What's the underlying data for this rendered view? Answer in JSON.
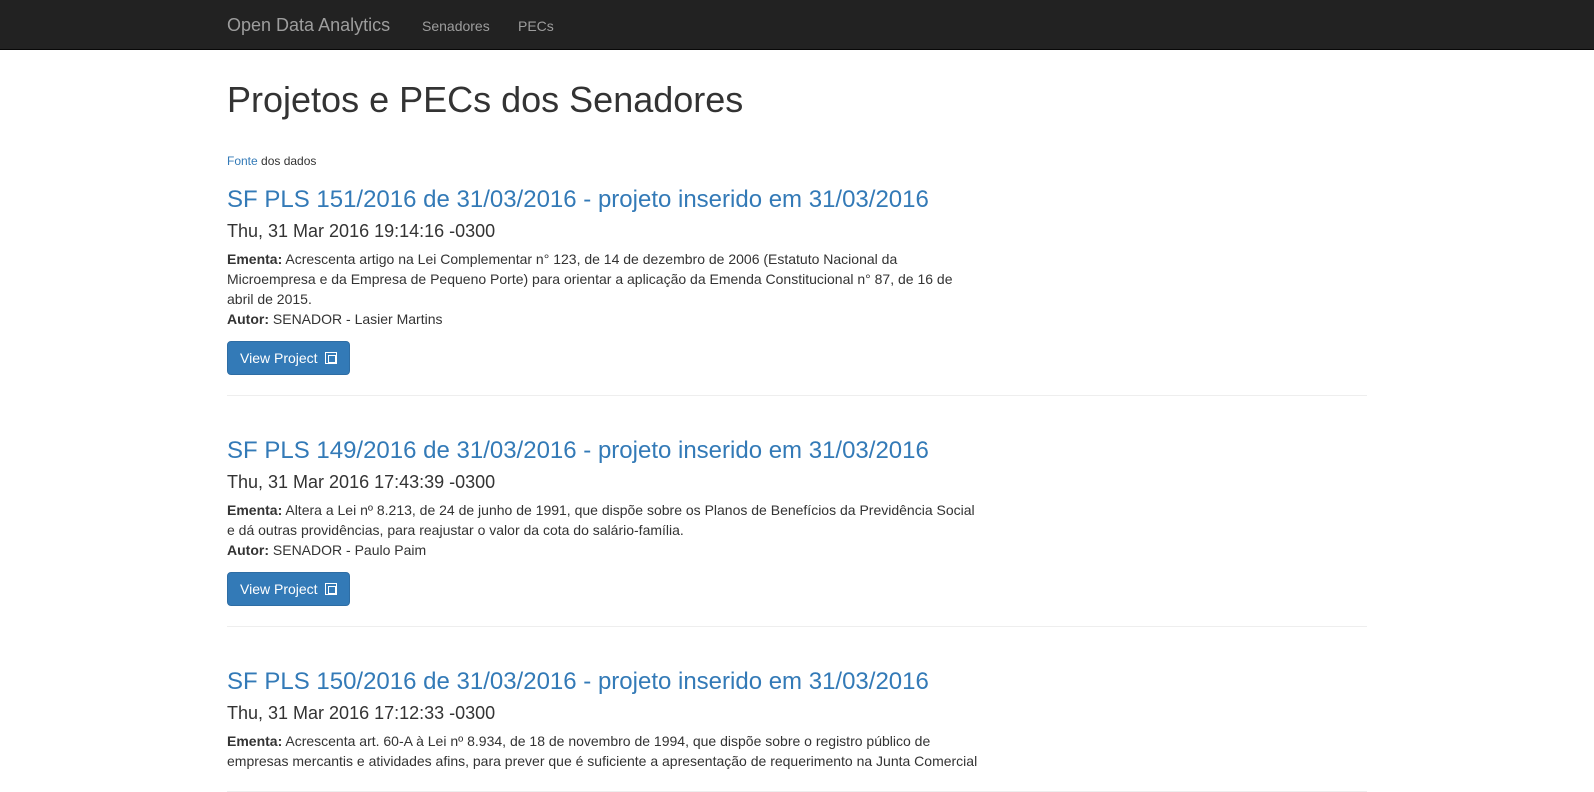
{
  "navbar": {
    "brand": "Open Data Analytics",
    "links": [
      "Senadores",
      "PECs"
    ]
  },
  "page": {
    "title": "Projetos e PECs dos Senadores",
    "source_link": "Fonte",
    "source_text": " dos dados"
  },
  "labels": {
    "ementa": "Ementa:",
    "autor": "Autor:",
    "button": "View Project"
  },
  "colors": {
    "navbar_bg": "#222222",
    "link": "#337ab7",
    "button_bg": "#337ab7"
  },
  "icons": {
    "button_icon": "external-link-icon"
  },
  "projects": [
    {
      "title": "SF PLS 151/2016 de 31/03/2016 - projeto inserido em 31/03/2016",
      "date": "Thu, 31 Mar 2016 19:14:16 -0300",
      "ementa": "Acrescenta artigo na Lei Complementar n° 123, de 14 de dezembro de 2006 (Estatuto Nacional da Microempresa e da Empresa de Pequeno Porte) para orientar a aplicação da Emenda Constitucional n° 87, de 16 de abril de 2015.",
      "autor": "SENADOR - Lasier Martins"
    },
    {
      "title": "SF PLS 149/2016 de 31/03/2016 - projeto inserido em 31/03/2016",
      "date": "Thu, 31 Mar 2016 17:43:39 -0300",
      "ementa": "Altera a Lei nº 8.213, de 24 de junho de 1991, que dispõe sobre os Planos de Benefícios da Previdência Social e dá outras providências, para reajustar o valor da cota do salário-família.",
      "autor": "SENADOR - Paulo Paim"
    },
    {
      "title": "SF PLS 150/2016 de 31/03/2016 - projeto inserido em 31/03/2016",
      "date": "Thu, 31 Mar 2016 17:12:33 -0300",
      "ementa": "Acrescenta art. 60-A à Lei nº 8.934, de 18 de novembro de 1994, que dispõe sobre o registro público de empresas mercantis e atividades afins, para prever que é suficiente a apresentação de requerimento na Junta Comercial",
      "autor": ""
    }
  ]
}
